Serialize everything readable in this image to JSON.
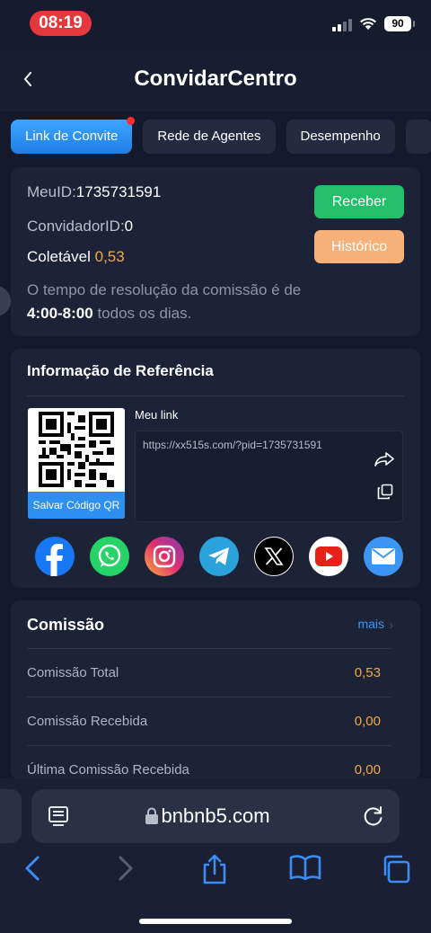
{
  "status": {
    "time": "08:19",
    "battery": "90"
  },
  "header": {
    "title": "ConvidarCentro"
  },
  "tabs": [
    {
      "label": "Link de Convite",
      "active": true
    },
    {
      "label": "Rede de Agentes"
    },
    {
      "label": "Desempenho"
    }
  ],
  "account": {
    "meu_id_label": "MeuID:",
    "meu_id": "1735731591",
    "convidador_label": "ConvidadorID:",
    "convidador_id": "0",
    "coletavel_label": "Coletável",
    "coletavel_value": "0,53",
    "receber_label": "Receber",
    "historico_label": "Histórico",
    "note_text": "O tempo de resolução da comissão é de",
    "note_hours": "4:00-8:00",
    "note_suffix": "todos os dias."
  },
  "referral": {
    "title": "Informação de Referência",
    "qr_save_label": "Salvar Código QR",
    "link_label": "Meu link",
    "link_url": "https://xx515s.com/?pid=1735731591",
    "socials": [
      "facebook-icon",
      "whatsapp-icon",
      "instagram-icon",
      "telegram-icon",
      "x-icon",
      "youtube-icon",
      "email-icon"
    ]
  },
  "commission": {
    "title": "Comissão",
    "more_label": "mais",
    "rows": [
      {
        "label": "Comissão Total",
        "value": "0,53"
      },
      {
        "label": "Comissão Recebida",
        "value": "0,00"
      },
      {
        "label": "Última Comissão Recebida",
        "value": "0,00"
      }
    ]
  },
  "browser": {
    "url": "bnbnb5.com"
  },
  "colors": {
    "accent": "#2d8ff0",
    "green": "#23bf6b",
    "orange": "#f6b07a",
    "value": "#f0a94a",
    "background": "#141a2c"
  }
}
